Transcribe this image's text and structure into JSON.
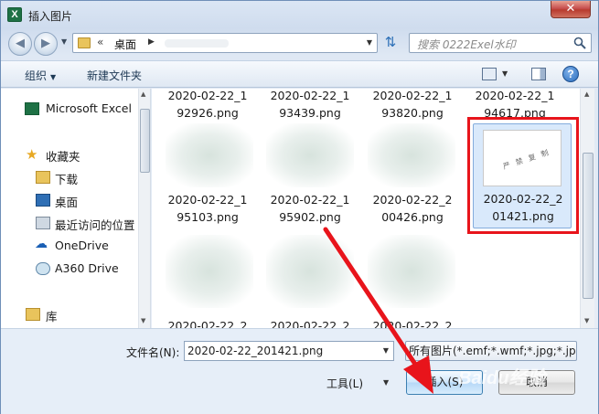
{
  "window": {
    "title": "插入图片",
    "app_icon_letter": "X",
    "close_glyph": "✕"
  },
  "address": {
    "breadcrumb_prefix": "«",
    "location": "桌面",
    "search_placeholder": "搜索 0222Exel水印"
  },
  "toolbar": {
    "organize_label": "组织",
    "new_folder_label": "新建文件夹",
    "help_glyph": "?"
  },
  "nav": {
    "items": [
      {
        "label": "Microsoft Excel",
        "icon": "excel-icon"
      },
      {
        "label": "收藏夹",
        "icon": "star-icon"
      },
      {
        "label": "下载",
        "icon": "download-folder-icon"
      },
      {
        "label": "桌面",
        "icon": "desktop-icon"
      },
      {
        "label": "最近访问的位置",
        "icon": "recent-places-icon"
      },
      {
        "label": "OneDrive",
        "icon": "cloud-icon"
      },
      {
        "label": "A360 Drive",
        "icon": "drive-icon"
      },
      {
        "label": "库",
        "icon": "library-icon"
      }
    ]
  },
  "files": {
    "row1": [
      {
        "line1": "2020-02-22_1",
        "line2": "92926.png"
      },
      {
        "line1": "2020-02-22_1",
        "line2": "93439.png"
      },
      {
        "line1": "2020-02-22_1",
        "line2": "93820.png"
      },
      {
        "line1": "2020-02-22_1",
        "line2": "94617.png"
      }
    ],
    "row2": [
      {
        "line1": "2020-02-22_1",
        "line2": "95103.png"
      },
      {
        "line1": "2020-02-22_1",
        "line2": "95902.png"
      },
      {
        "line1": "2020-02-22_2",
        "line2": "00426.png"
      },
      {
        "line1": "2020-02-22_2",
        "line2": "01421.png"
      }
    ],
    "row3": [
      {
        "line1": "2020-02-22_2"
      },
      {
        "line1": "2020-02-22_2"
      },
      {
        "line1": "2020-02-22_2"
      }
    ],
    "selected_thumb_text": "严 禁 复 制"
  },
  "footer": {
    "filename_label": "文件名(N):",
    "filename_value": "2020-02-22_201421.png",
    "filter_value": "所有图片(*.emf;*.wmf;*.jpg;*.jp",
    "tools_label": "工具(L)",
    "insert_label": "插入(S)",
    "cancel_label": "取消",
    "watermark_text": "Baidu经验"
  },
  "colors": {
    "highlight_box": "#e8141b",
    "arrow": "#e8141b",
    "selection": "#d9e9fb"
  }
}
